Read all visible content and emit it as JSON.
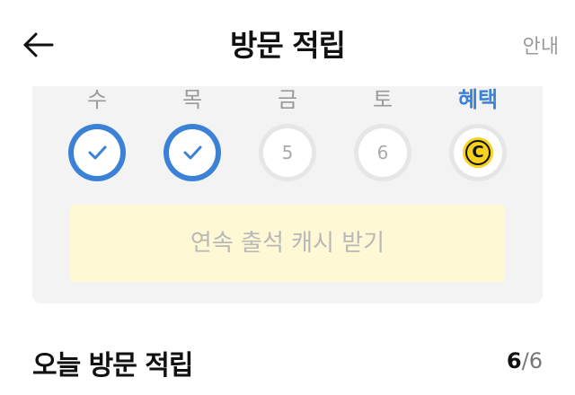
{
  "header": {
    "title": "방문 적립",
    "guide_label": "안내"
  },
  "days": [
    {
      "label": "수",
      "state": "checked"
    },
    {
      "label": "목",
      "state": "checked"
    },
    {
      "label": "금",
      "state": "pending",
      "number": "5"
    },
    {
      "label": "토",
      "state": "pending",
      "number": "6"
    },
    {
      "label": "혜택",
      "state": "benefit",
      "coin_letter": "C"
    }
  ],
  "cta": {
    "label": "연속 출석 캐시 받기"
  },
  "section": {
    "title": "오늘 방문 적립",
    "current": "6",
    "separator": "/",
    "total": "6"
  },
  "colors": {
    "accent": "#3b82d6",
    "coin": "#f7d21d",
    "cta_bg": "#fef9d4"
  }
}
